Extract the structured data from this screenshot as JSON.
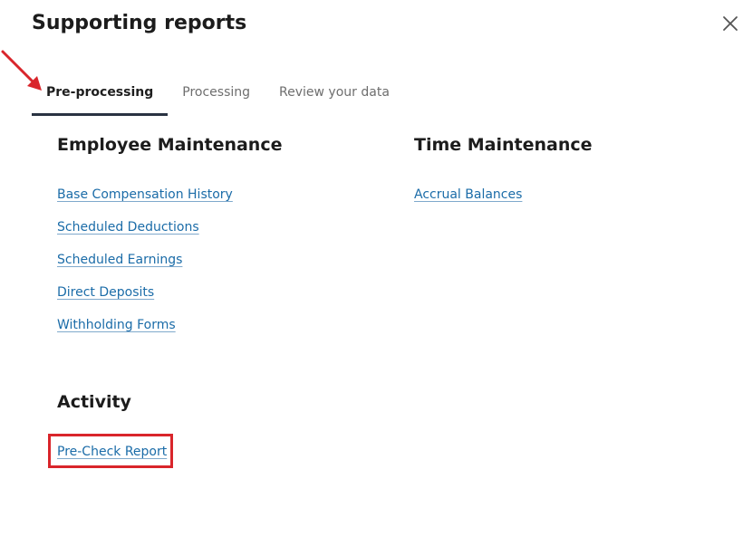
{
  "modal": {
    "title": "Supporting reports"
  },
  "tabs": [
    {
      "label": "Pre-processing",
      "active": true
    },
    {
      "label": "Processing",
      "active": false
    },
    {
      "label": "Review your data",
      "active": false
    }
  ],
  "sections": {
    "employee_maintenance": {
      "heading": "Employee Maintenance",
      "links": [
        "Base Compensation History",
        "Scheduled Deductions",
        "Scheduled Earnings",
        "Direct Deposits",
        "Withholding Forms"
      ]
    },
    "time_maintenance": {
      "heading": "Time Maintenance",
      "links": [
        "Accrual Balances"
      ]
    },
    "activity": {
      "heading": "Activity",
      "links": [
        "Pre-Check Report"
      ]
    }
  },
  "icons": {
    "close": "close-icon",
    "annotation_arrow": "arrow-icon"
  },
  "colors": {
    "link": "#1b6ca8",
    "active_tab_underline": "#2a3342",
    "annotation_red": "#d9252b"
  }
}
